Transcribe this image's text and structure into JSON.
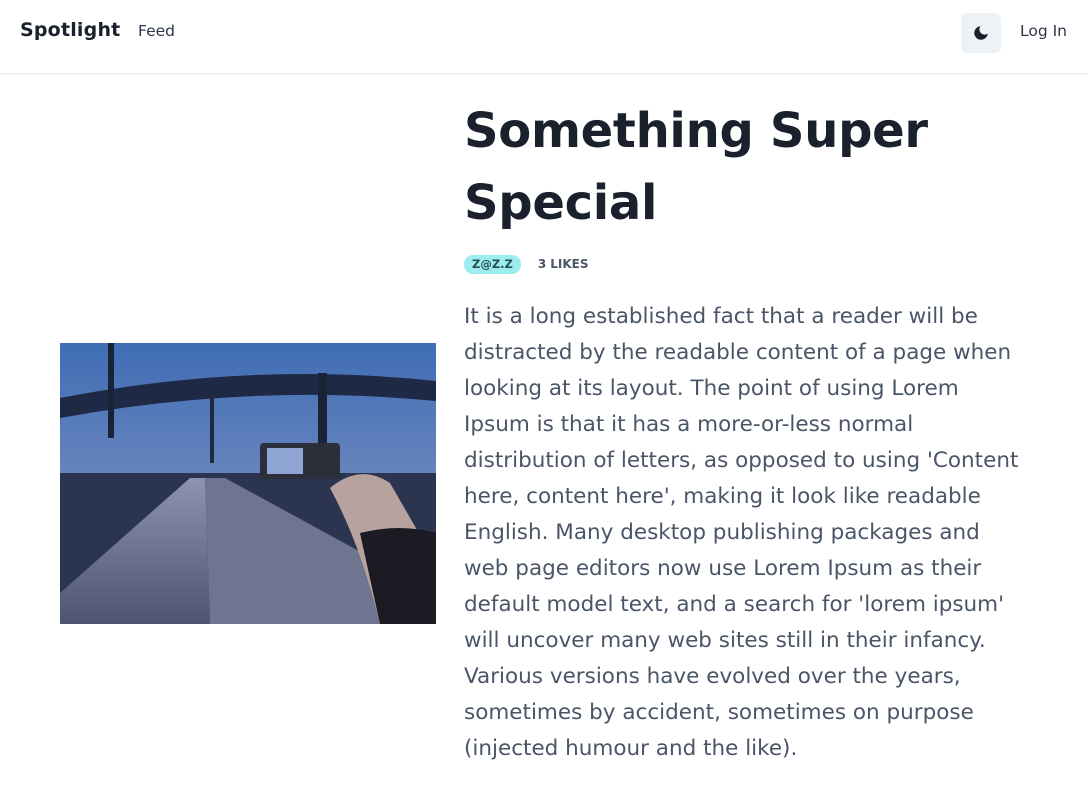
{
  "header": {
    "brand": "Spotlight",
    "nav_link": "Feed",
    "theme_toggle_icon": "moon-icon",
    "login_label": "Log In"
  },
  "post": {
    "title": "Something Super Special",
    "author_badge": "Z@Z.Z",
    "likes_count": "3",
    "likes_label": "LIKES",
    "body": "It is a long established fact that a reader will be distracted by the readable content of a page when looking at its layout. The point of using Lorem Ipsum is that it has a more-or-less normal distribution of letters, as opposed to using 'Content here, content here', making it look like readable English. Many desktop publishing packages and web page editors now use Lorem Ipsum as their default model text, and a search for 'lorem ipsum' will uncover many web sites still in their infancy. Various versions have evolved over the years, sometimes by accident, sometimes on purpose (injected humour and the like)."
  },
  "colors": {
    "badge_bg": "#9decf0",
    "badge_text": "#234e52",
    "heading": "#1a202c",
    "body_text": "#4a5568",
    "toggle_bg": "#edf2f7"
  }
}
